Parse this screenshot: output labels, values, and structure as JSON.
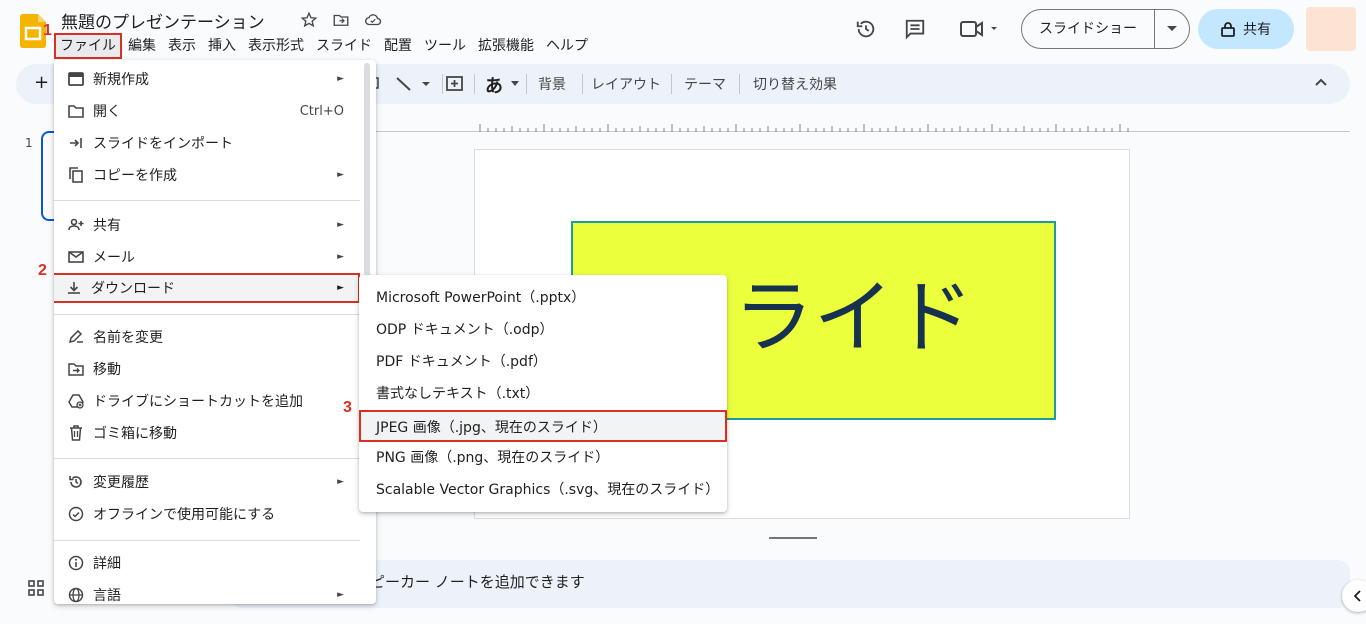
{
  "app": {
    "doc_title": "無題のプレゼンテーション",
    "menus": [
      "ファイル",
      "編集",
      "表示",
      "挿入",
      "表示形式",
      "スライド",
      "配置",
      "ツール",
      "拡張機能",
      "ヘルプ"
    ],
    "slideshow_label": "スライドショー",
    "share_label": "共有"
  },
  "toolbar": {
    "add": "+",
    "text_style": "あ",
    "background": "背景",
    "layout": "レイアウト",
    "theme": "テーマ",
    "transition": "切り替え効果"
  },
  "filmstrip": {
    "slide_number": "1"
  },
  "slide": {
    "text": "スライド",
    "box_color": "#ebff3d",
    "border_color": "#1f9aa0"
  },
  "notes": {
    "placeholder": "ピーカー ノートを追加できます"
  },
  "file_menu": {
    "items": [
      {
        "label": "新規作成",
        "icon": "slides-icon",
        "submenu": true
      },
      {
        "label": "開く",
        "icon": "folder-icon",
        "shortcut": "Ctrl+O"
      },
      {
        "label": "スライドをインポート",
        "icon": "import-icon"
      },
      {
        "label": "コピーを作成",
        "icon": "copy-icon",
        "submenu": true
      },
      {
        "label": "共有",
        "icon": "person-add-icon",
        "submenu": true
      },
      {
        "label": "メール",
        "icon": "mail-icon",
        "submenu": true
      },
      {
        "label": "ダウンロード",
        "icon": "download-icon",
        "submenu": true
      },
      {
        "label": "名前を変更",
        "icon": "rename-icon"
      },
      {
        "label": "移動",
        "icon": "move-folder-icon"
      },
      {
        "label": "ドライブにショートカットを追加",
        "icon": "drive-shortcut-icon"
      },
      {
        "label": "ゴミ箱に移動",
        "icon": "trash-icon"
      },
      {
        "label": "変更履歴",
        "icon": "history-icon",
        "submenu": true
      },
      {
        "label": "オフラインで使用可能にする",
        "icon": "offline-icon"
      },
      {
        "label": "詳細",
        "icon": "info-icon"
      },
      {
        "label": "言語",
        "icon": "globe-icon",
        "submenu": true
      }
    ]
  },
  "download_menu": {
    "items": [
      "Microsoft PowerPoint（.pptx）",
      "ODP ドキュメント（.odp）",
      "PDF ドキュメント（.pdf）",
      "書式なしテキスト（.txt）",
      "JPEG 画像（.jpg、現在のスライド）",
      "PNG 画像（.png、現在のスライド）",
      "Scalable Vector Graphics（.svg、現在のスライド）"
    ]
  },
  "annotations": {
    "step1": "1",
    "step2": "2",
    "step3": "3",
    "color": "#d93025"
  }
}
